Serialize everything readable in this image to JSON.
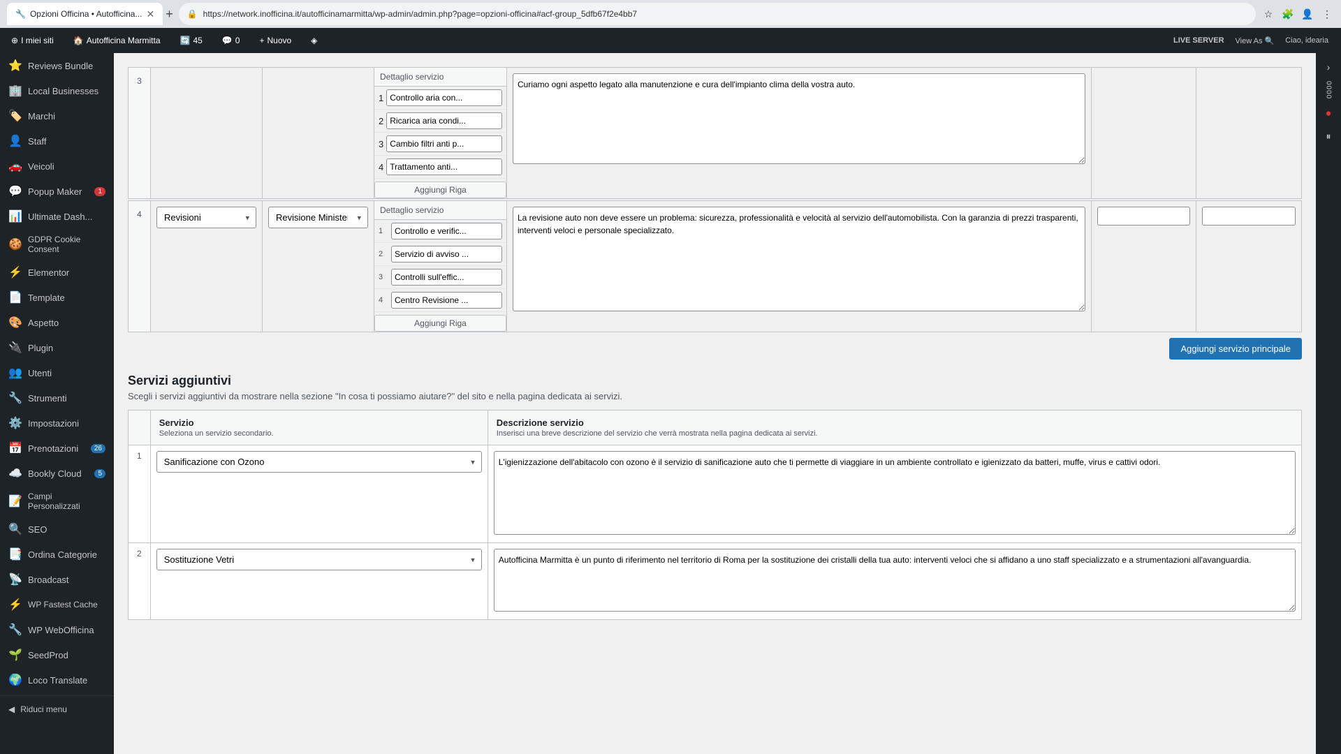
{
  "browser": {
    "tab_title": "Opzioni Officina • Autofficina...",
    "url": "https://network.inofficina.it/autofficinamarmitta/wp-admin/admin.php?page=opzioni-officina#acf-group_5dfb67f2e4bb7",
    "new_tab_label": "+",
    "favicon": "🔧"
  },
  "admin_bar": {
    "my_sites": "I miei siti",
    "site_name": "Autofficina Marmitta",
    "updates": "45",
    "comments": "0",
    "new": "Nuovo",
    "live_server": "LIVE SERVER",
    "view_as": "View As",
    "greeting": "Ciao, idearia"
  },
  "sidebar": {
    "items": [
      {
        "id": "reviews-bundle",
        "icon": "⭐",
        "label": "Reviews Bundle",
        "badge": null
      },
      {
        "id": "local-businesses",
        "icon": "🏢",
        "label": "Local Businesses",
        "badge": null
      },
      {
        "id": "marchi",
        "icon": "🏷️",
        "label": "Marchi",
        "badge": null
      },
      {
        "id": "staff",
        "icon": "👤",
        "label": "Staff",
        "badge": null
      },
      {
        "id": "veicoli",
        "icon": "🚗",
        "label": "Veicoli",
        "badge": null
      },
      {
        "id": "popup-maker",
        "icon": "💬",
        "label": "Popup Maker",
        "badge": "1"
      },
      {
        "id": "ultimate-dash",
        "icon": "📊",
        "label": "Ultimate Dash...",
        "badge": null
      },
      {
        "id": "gdpr-cookie",
        "icon": "🍪",
        "label": "GDPR Cookie Consent",
        "badge": null
      },
      {
        "id": "elementor",
        "icon": "⚡",
        "label": "Elementor",
        "badge": null
      },
      {
        "id": "template",
        "icon": "📄",
        "label": "Template",
        "badge": null
      },
      {
        "id": "aspetto",
        "icon": "🎨",
        "label": "Aspetto",
        "badge": null
      },
      {
        "id": "plugin",
        "icon": "🔌",
        "label": "Plugin",
        "badge": null
      },
      {
        "id": "utenti",
        "icon": "👥",
        "label": "Utenti",
        "badge": null
      },
      {
        "id": "strumenti",
        "icon": "🔧",
        "label": "Strumenti",
        "badge": null
      },
      {
        "id": "impostazioni",
        "icon": "⚙️",
        "label": "Impostazioni",
        "badge": null
      },
      {
        "id": "prenotazioni",
        "icon": "📅",
        "label": "Prenotazioni",
        "badge": "26",
        "badge_color": "blue"
      },
      {
        "id": "bookly-cloud",
        "icon": "☁️",
        "label": "Bookly Cloud",
        "badge": "5",
        "badge_color": "blue"
      },
      {
        "id": "campi-personalizzati",
        "icon": "📝",
        "label": "Campi Personalizzati",
        "badge": null
      },
      {
        "id": "seo",
        "icon": "🔍",
        "label": "SEO",
        "badge": null
      },
      {
        "id": "ordina-categorie",
        "icon": "📑",
        "label": "Ordina Categorie",
        "badge": null
      },
      {
        "id": "broadcast",
        "icon": "📡",
        "label": "Broadcast",
        "badge": null
      },
      {
        "id": "wp-fastest-cache",
        "icon": "⚡",
        "label": "WP Fastest Cache",
        "badge": null
      },
      {
        "id": "wp-web-officina",
        "icon": "🔧",
        "label": "WP WebOfficina",
        "badge": null
      },
      {
        "id": "seed-prod",
        "icon": "🌱",
        "label": "SeedProd",
        "badge": null
      },
      {
        "id": "loco-translate",
        "icon": "🌍",
        "label": "Loco Translate",
        "badge": null
      }
    ],
    "collapse": "Riduci menu"
  },
  "content": {
    "section3": {
      "row_num": "3",
      "services": [
        {
          "id": 1,
          "label": "Controllo aria con..."
        },
        {
          "id": 2,
          "label": "Ricarica aria condi..."
        },
        {
          "id": 3,
          "label": "Cambio filtri anti p..."
        },
        {
          "id": 4,
          "label": "Trattamento anti..."
        }
      ],
      "description": "Curiamo ogni aspetto legato alla manutenzione e cura dell'impianto clima della vostra auto.",
      "aggiungi_riga": "Aggiungi Riga"
    },
    "section4": {
      "row_num": "4",
      "categoria": "Revisioni",
      "sottocategoria": "Revisione Ministeriale",
      "dettaglio_header": "Dettaglio servizio",
      "services": [
        {
          "id": 1,
          "label": "Controllo e verific..."
        },
        {
          "id": 2,
          "label": "Servizio di avviso ..."
        },
        {
          "id": 3,
          "label": "Controlli sull'effic..."
        },
        {
          "id": 4,
          "label": "Centro Revisione ..."
        }
      ],
      "description": "La revisione auto non deve essere un problema: sicurezza, professionalità e velocità al servizio dell'automobilista. Con la garanzia di prezzi trasparenti, interventi veloci e personale specializzato.",
      "input1": "",
      "input2": "",
      "aggiungi_riga": "Aggiungi Riga"
    },
    "aggiungi_servizio_principale": "Aggiungi servizio principale",
    "servizi_aggiuntivi": {
      "title": "Servizi aggiuntivi",
      "description": "Scegli i servizi aggiuntivi da mostrare nella sezione \"In cosa ti possiamo aiutare?\" del sito e nella pagina dedicata ai servizi.",
      "table_headers": {
        "servizio": "Servizio",
        "servizio_sub": "Seleziona un servizio secondario.",
        "descrizione": "Descrizione servizio",
        "descrizione_sub": "Inserisci una breve descrizione del servizio che verrà mostrata nella pagina dedicata ai servizi."
      },
      "rows": [
        {
          "row_num": "1",
          "servizio": "Sanificazione con Ozono",
          "descrizione": "L'igienizzazione dell'abitacolo con ozono è il servizio di sanificazione auto che ti permette di viaggiare in un ambiente controllato e igienizzato da batteri, muffe, virus e cattivi odori."
        },
        {
          "row_num": "2",
          "servizio": "Sostituzione Vetri",
          "descrizione": "Autofficina Marmitta è un punto di riferimento nel territorio di Roma per la sostituzione dei cristalli della tua auto: interventi veloci che si affidano a uno staff specializzato e a strumentazioni all'avanguardia."
        }
      ]
    }
  },
  "right_panel": {
    "arrow_icon": "›",
    "dots": "0000",
    "record_icon": "⏺",
    "pause_icon": "⏸"
  }
}
